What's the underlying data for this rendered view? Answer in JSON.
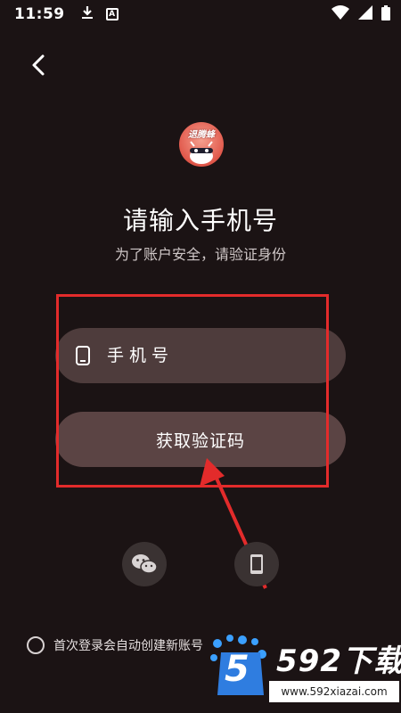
{
  "status_bar": {
    "time": "11:59",
    "notification_badge": "A",
    "icons": [
      "download-icon",
      "a-badge-icon",
      "wifi-icon",
      "signal-icon",
      "battery-icon"
    ]
  },
  "header": {
    "back_icon": "chevron-left-icon"
  },
  "logo": {
    "text": "退腾蜂"
  },
  "main": {
    "title": "请输入手机号",
    "subtitle": "为了账户安全，请验证身份"
  },
  "phone_field": {
    "icon": "phone-icon",
    "placeholder": "手机号",
    "value": ""
  },
  "get_code_button": {
    "label": "获取验证码"
  },
  "social": {
    "wechat_icon": "wechat-icon",
    "phone_login_icon": "phone-login-icon"
  },
  "agreement": {
    "text": "首次登录会自动创建新账号"
  },
  "watermark": {
    "brand": "592下载",
    "url": "www.592xiazai.com",
    "logo_glyph": "5"
  },
  "annotation": {
    "box_color": "#e32b2b",
    "arrow_color": "#e32b2b"
  },
  "colors": {
    "background": "#1b1314",
    "field_bg": "#4e3c3c",
    "button_bg": "#5b4444",
    "social_bg": "#3a3232"
  }
}
